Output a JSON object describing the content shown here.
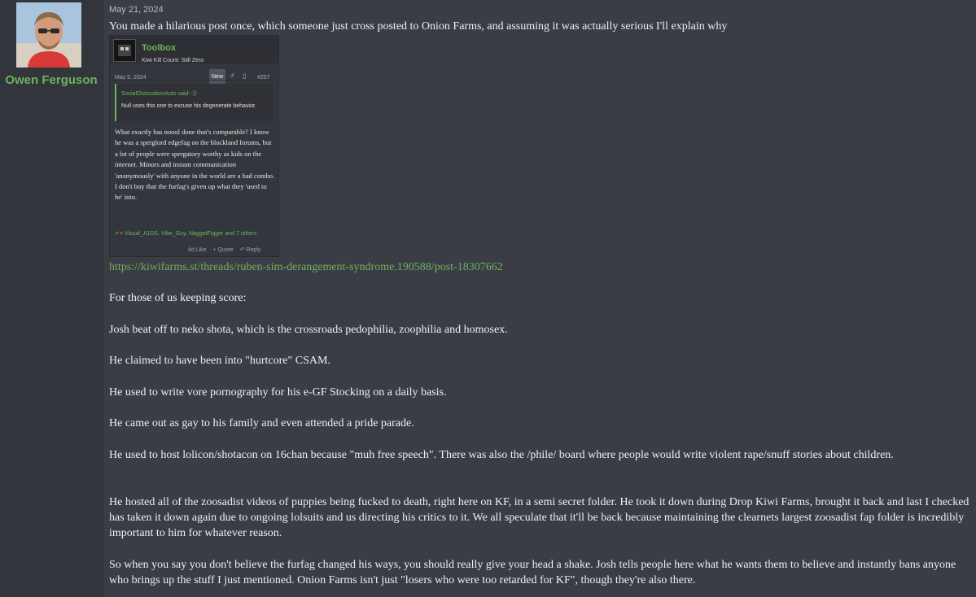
{
  "user": {
    "name": "Owen Ferguson"
  },
  "post": {
    "date": "May 21, 2024",
    "intro": "You made a hilarious post once, which someone just cross posted to Onion Farms, and assuming it was actually serious I'll explain why",
    "embed": {
      "name": "Toolbox",
      "tagline": "Kiwi Kill Count: Still Zero",
      "date": "May 5, 2024",
      "new_badge": "New",
      "share_icon": "share-icon",
      "bookmark_icon": "bookmark-icon",
      "post_number": "#207",
      "quote_author": "SocialDislocationAuto said: Ⓢ",
      "quote_text": "Null uses this one to excuse his degenerate behavior.",
      "body": "What exactly has noool done that's comparable? I know he was a sperglord edgefag on the blockland forums, but a lot of people were spergatory worthy as kids on the internet. Minors and instant communication 'anonymously' with anyone in the world are a bad combo. I don't buy that the furfag's given up what they 'used to be' into.",
      "reactions": "Visual_A1DS, Vibe_Guy, NaggotFigger and 7 others",
      "like": "ὄd Like",
      "quote": "+ Quote",
      "reply": "↶ Reply"
    },
    "link": "https://kiwifarms.st/threads/ruben-sim-derangement-syndrome.190588/post-18307662",
    "paragraphs": [
      "For those of us keeping score:",
      "Josh beat off to neko shota, which is the crossroads pedophilia, zoophilia and homosex.",
      "He claimed to have been into \"hurtcore\" CSAM.",
      "He used to write vore pornography for his e-GF Stocking on a daily basis.",
      "He came out as gay to his family and even attended a pride parade.",
      "He used to host lolicon/shotacon on 16chan because \"muh free speech\". There was also the /phile/ board where people would write violent rape/snuff stories about children.",
      "He hosted all of the zoosadist videos of puppies being fucked to death, right here on KF, in a semi secret folder. He took it down during Drop Kiwi Farms, brought it back and last I checked has taken it down again due to ongoing lolsuits and us directing his critics to it. We all speculate that it'll be back because maintaining the clearnets largest zoosadist fap folder is incredibly important to him for whatever reason.",
      "So when you say you don't believe the furfag changed his ways, you should really give your head a shake. Josh tells people here what he wants them to believe and instantly bans anyone who brings up the stuff I just mentioned. Onion Farms isn't just \"losers who were too retarded for KF\", though they're also there."
    ]
  }
}
